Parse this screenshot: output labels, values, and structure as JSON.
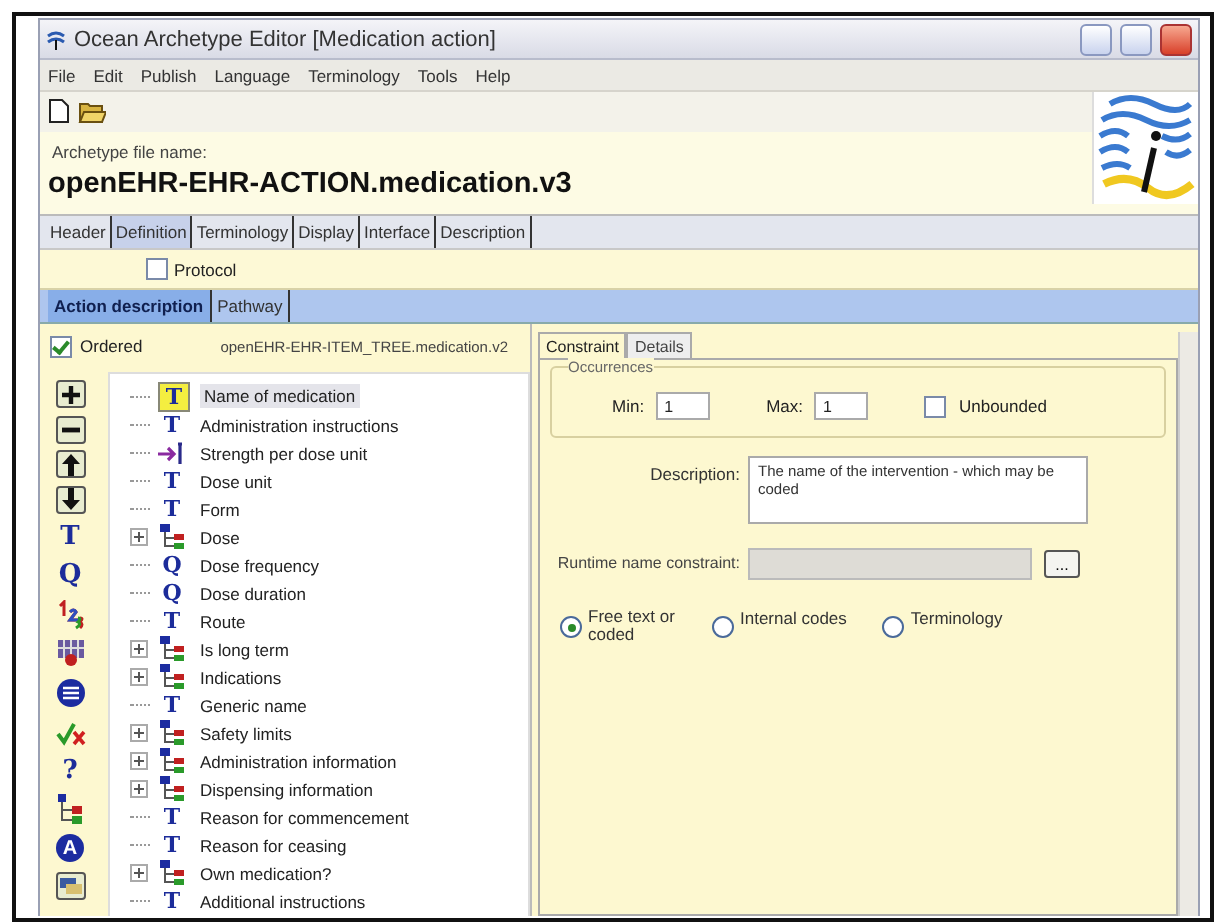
{
  "window": {
    "title": "Ocean Archetype Editor [Medication action]"
  },
  "menu": [
    "File",
    "Edit",
    "Publish",
    "Language",
    "Terminology",
    "Tools",
    "Help"
  ],
  "archetype": {
    "label": "Archetype file name:",
    "name": "openEHR-EHR-ACTION.medication.v3"
  },
  "tabs": [
    {
      "label": "Header",
      "selected": false
    },
    {
      "label": "Definition",
      "selected": true
    },
    {
      "label": "Terminology",
      "selected": false
    },
    {
      "label": "Display",
      "selected": false
    },
    {
      "label": "Interface",
      "selected": false
    },
    {
      "label": "Description",
      "selected": false
    }
  ],
  "protocol": {
    "label": "Protocol",
    "checked": false
  },
  "subtabs": [
    {
      "label": "Action description",
      "selected": true
    },
    {
      "label": "Pathway",
      "selected": false
    }
  ],
  "ordered": {
    "label": "Ordered",
    "checked": true
  },
  "tree_path": "openEHR-EHR-ITEM_TREE.medication.v2",
  "tools": [
    {
      "kind": "add"
    },
    {
      "kind": "remove"
    },
    {
      "kind": "up"
    },
    {
      "kind": "down"
    },
    {
      "kind": "glyph",
      "glyph": "T"
    },
    {
      "kind": "glyph",
      "glyph": "Q"
    },
    {
      "kind": "count"
    },
    {
      "kind": "ordinal"
    },
    {
      "kind": "list"
    },
    {
      "kind": "boolean"
    },
    {
      "kind": "glyph",
      "glyph": "?"
    },
    {
      "kind": "cluster"
    },
    {
      "kind": "circle",
      "glyph": "A"
    },
    {
      "kind": "slot"
    }
  ],
  "tree": [
    {
      "label": "Name of medication",
      "kind": "text",
      "glyph": "T",
      "selected": true
    },
    {
      "label": "Administration instructions",
      "kind": "text",
      "glyph": "T",
      "selected": false
    },
    {
      "label": "Strength per dose unit",
      "kind": "proportion",
      "selected": false
    },
    {
      "label": "Dose unit",
      "kind": "text",
      "glyph": "T",
      "selected": false
    },
    {
      "label": "Form",
      "kind": "text",
      "glyph": "T",
      "selected": false
    },
    {
      "label": "Dose",
      "kind": "cluster",
      "expanded": false,
      "selected": false
    },
    {
      "label": "Dose frequency",
      "kind": "text",
      "glyph": "Q",
      "selected": false
    },
    {
      "label": "Dose duration",
      "kind": "text",
      "glyph": "Q",
      "selected": false
    },
    {
      "label": "Route",
      "kind": "text",
      "glyph": "T",
      "selected": false
    },
    {
      "label": "Is long term",
      "kind": "cluster",
      "expanded": false,
      "selected": false
    },
    {
      "label": "Indications",
      "kind": "cluster",
      "expanded": false,
      "selected": false
    },
    {
      "label": "Generic name",
      "kind": "text",
      "glyph": "T",
      "selected": false
    },
    {
      "label": "Safety limits",
      "kind": "cluster",
      "expanded": false,
      "selected": false
    },
    {
      "label": "Administration information",
      "kind": "cluster",
      "expanded": false,
      "selected": false
    },
    {
      "label": "Dispensing information",
      "kind": "cluster",
      "expanded": false,
      "selected": false
    },
    {
      "label": "Reason for commencement",
      "kind": "text",
      "glyph": "T",
      "selected": false
    },
    {
      "label": "Reason for ceasing",
      "kind": "text",
      "glyph": "T",
      "selected": false
    },
    {
      "label": "Own medication?",
      "kind": "cluster",
      "expanded": false,
      "selected": false
    },
    {
      "label": "Additional instructions",
      "kind": "text",
      "glyph": "T",
      "selected": false
    }
  ],
  "detail_tabs": [
    {
      "label": "Constraint",
      "selected": true
    },
    {
      "label": "Details",
      "selected": false
    }
  ],
  "occurrences": {
    "title": "Occurrences",
    "min_label": "Min:",
    "min": "1",
    "max_label": "Max:",
    "max": "1",
    "unbounded": {
      "label": "Unbounded",
      "checked": false
    }
  },
  "description": {
    "label": "Description:",
    "value": "The name of the intervention - which may be coded"
  },
  "runtime": {
    "label": "Runtime name constraint:",
    "button": "...",
    "disabled": true
  },
  "options": [
    {
      "label": "Free text or coded",
      "selected": true
    },
    {
      "label": "Internal codes",
      "selected": false
    },
    {
      "label": "Terminology",
      "selected": false
    }
  ]
}
